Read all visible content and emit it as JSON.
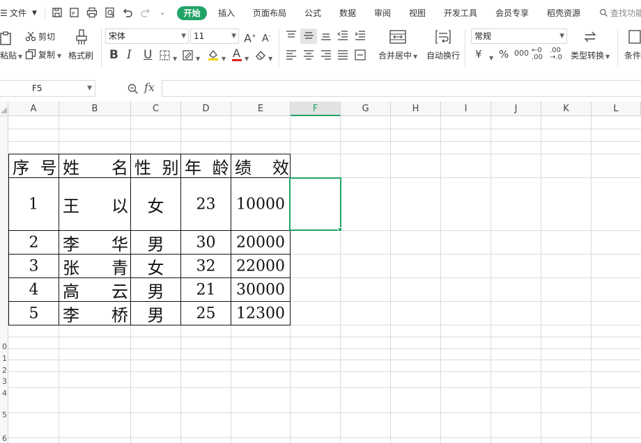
{
  "menubar": {
    "file": "文件",
    "tabs": [
      "开始",
      "插入",
      "页面布局",
      "公式",
      "数据",
      "审阅",
      "视图",
      "开发工具",
      "会员专享",
      "稻壳资源"
    ],
    "search": "查找功能"
  },
  "ribbon": {
    "paste": "粘贴",
    "cut": "剪切",
    "copy": "复制",
    "format_painter": "格式刷",
    "font_name": "宋体",
    "font_size": "11",
    "bold": "B",
    "italic": "I",
    "underline": "U",
    "merge_center": "合并居中",
    "wrap_text": "自动换行",
    "number_format": "常规",
    "currency": "¥",
    "percent": "%",
    "thousands": "000",
    "type_convert": "类型转换",
    "conditional": "条件"
  },
  "formula_bar": {
    "cell_ref": "F5",
    "fx_label": "fx",
    "value": ""
  },
  "sheet": {
    "columns": [
      "A",
      "B",
      "C",
      "D",
      "E",
      "F",
      "G",
      "H",
      "I",
      "J",
      "K",
      "L"
    ],
    "selected_column": "F",
    "partial_row_numbers": [
      "0",
      "1",
      "2",
      "3",
      "4",
      "5",
      "6"
    ],
    "table": {
      "headers": [
        "序号",
        "姓名",
        "性别",
        "年龄",
        "绩效"
      ],
      "header_display": [
        "序 号",
        "姓    名",
        "性 别",
        "年 龄",
        "绩  效"
      ],
      "rows": [
        {
          "no": "1",
          "name_first": "王",
          "name_last": "以",
          "gender": "女",
          "age": "23",
          "perf": "10000"
        },
        {
          "no": "2",
          "name_first": "李",
          "name_last": "华",
          "gender": "男",
          "age": "30",
          "perf": "20000"
        },
        {
          "no": "3",
          "name_first": "张",
          "name_last": "青",
          "gender": "女",
          "age": "32",
          "perf": "22000"
        },
        {
          "no": "4",
          "name_first": "高",
          "name_last": "云",
          "gender": "男",
          "age": "21",
          "perf": "30000"
        },
        {
          "no": "5",
          "name_first": "李",
          "name_last": "桥",
          "gender": "男",
          "age": "25",
          "perf": "12300"
        }
      ]
    }
  },
  "colors": {
    "accent": "#21a365",
    "grid": "#dadada",
    "border": "#111111"
  }
}
